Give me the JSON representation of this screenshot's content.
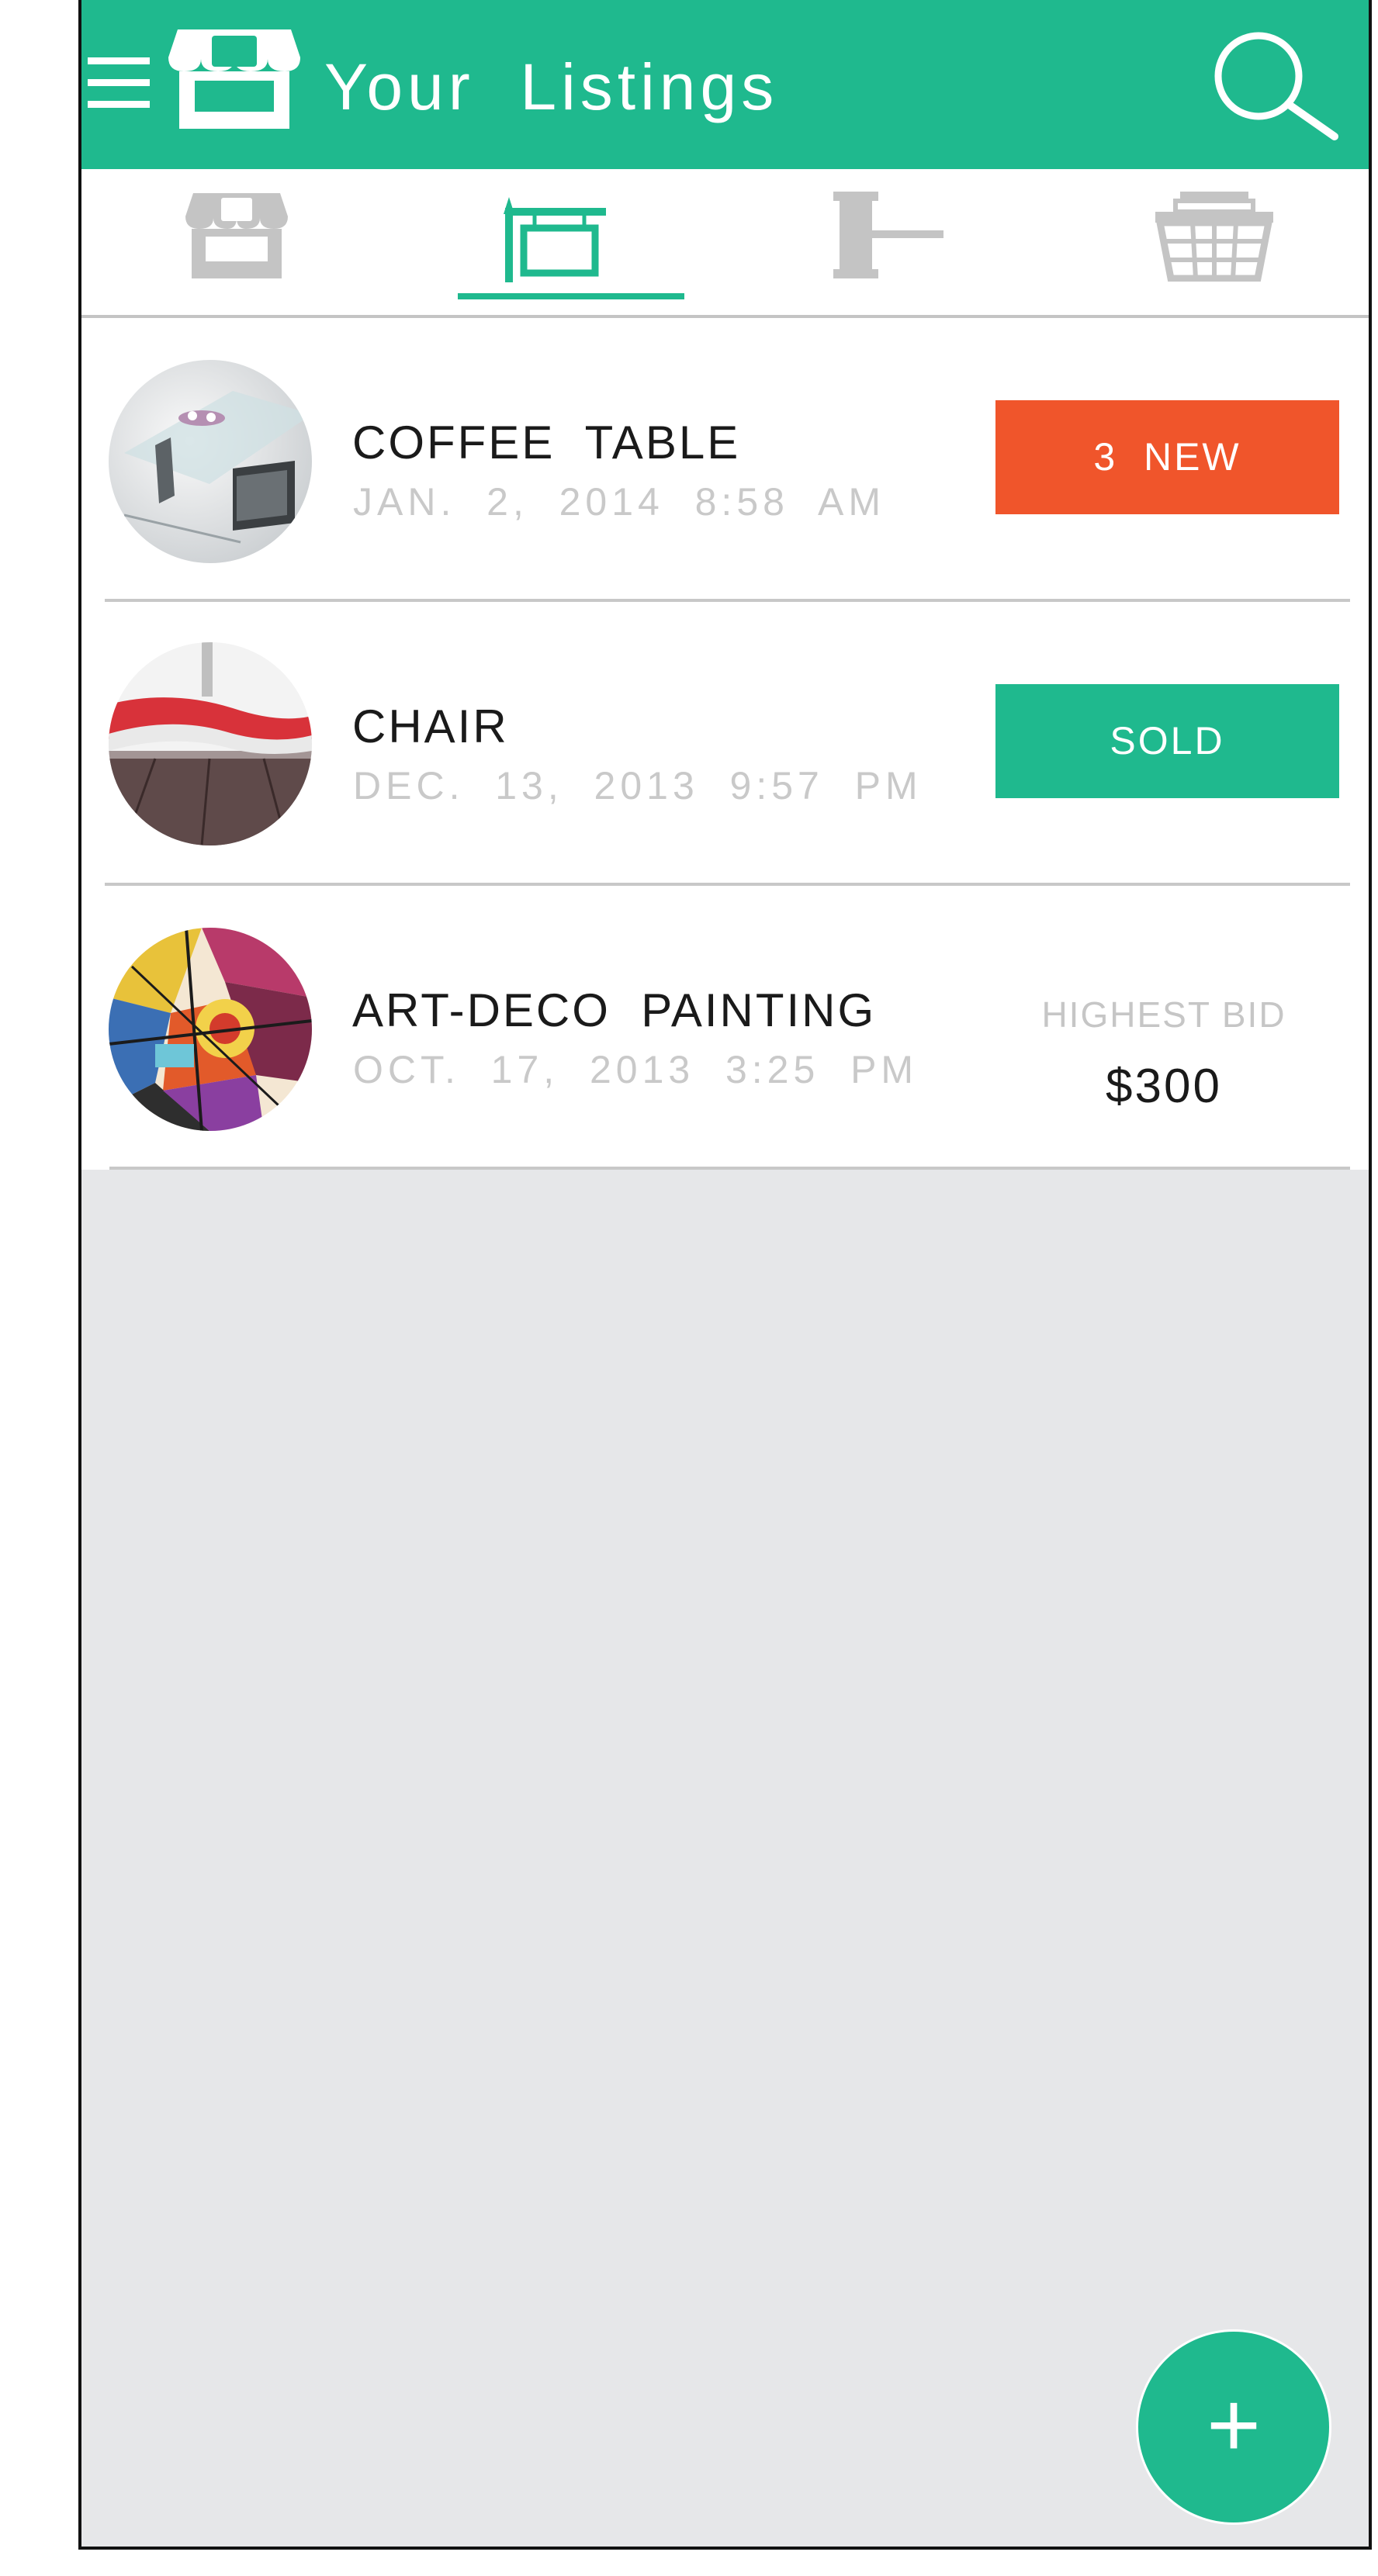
{
  "header": {
    "title": "Your  Listings",
    "menu_icon": "hamburger-menu-icon",
    "logo_icon": "storefront-icon",
    "search_icon": "search-icon"
  },
  "tabs": [
    {
      "name": "shop",
      "icon": "storefront-icon",
      "active": false
    },
    {
      "name": "listings",
      "icon": "signboard-icon",
      "active": true
    },
    {
      "name": "auctions",
      "icon": "gavel-icon",
      "active": false
    },
    {
      "name": "cart",
      "icon": "basket-icon",
      "active": false
    }
  ],
  "listings": [
    {
      "name": "COFFEE  TABLE",
      "date": "JAN.  2,  2014  8:58  AM",
      "badge": "3  NEW",
      "badge_color": "#f0552b"
    },
    {
      "name": "CHAIR",
      "date": "DEC.  13,  2013  9:57  PM",
      "badge": "SOLD",
      "badge_color": "#1fb98e"
    },
    {
      "name": "ART-DECO  PAINTING",
      "date": "OCT.  17,  2013  3:25  PM",
      "bid_label": "HIGHEST  BID",
      "bid_value": "$300"
    }
  ],
  "fab": {
    "label": "+",
    "icon": "add-icon"
  },
  "colors": {
    "accent": "#1fb98e",
    "alert": "#f0552b",
    "inactive_icon": "#c4c4c4",
    "background": "#e6e7e9"
  }
}
